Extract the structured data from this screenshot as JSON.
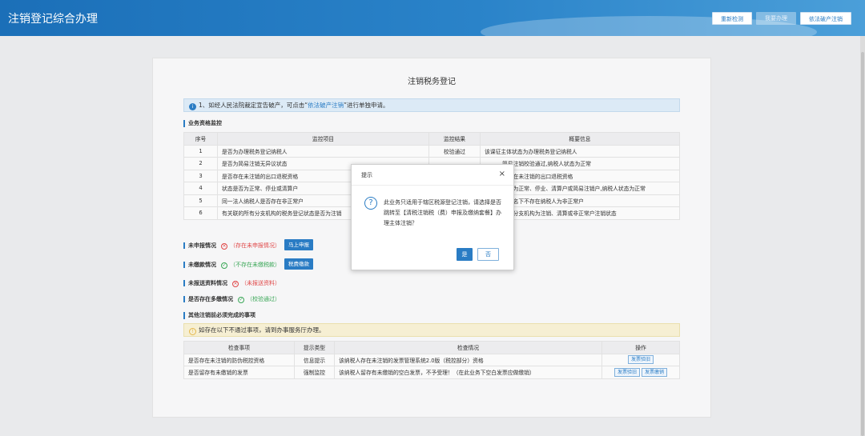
{
  "header": {
    "title": "注销登记综合办理",
    "buttons": [
      "重新检测",
      "我要办理",
      "依法破产注销"
    ]
  },
  "card": {
    "title": "注销税务登记",
    "notice": {
      "prefix": "1、如经人民法院裁定宣告破产，可点击“",
      "link": "依法破产注销",
      "suffix": "”进行单独申请。"
    },
    "business_section": "业务资格监控",
    "table1": {
      "headers": [
        "序号",
        "监控项目",
        "监控结果",
        "概要信息"
      ],
      "rows": [
        [
          "1",
          "是否为办理税务登记纳税人",
          "校验通过",
          "该课征主体状态为办理税务登记纳税人"
        ],
        [
          "2",
          "是否为简易注销无异议状态",
          "",
          "简易注销校验通过,纳税人状态为正常"
        ],
        [
          "3",
          "是否存在未注销的出口退税资格",
          "",
          "不存在未注销的出口退税资格"
        ],
        [
          "4",
          "状态是否为正常、停业或清算户",
          "",
          "状态为正常、停业、清算户或简易注销户,纳税人状态为正常"
        ],
        [
          "5",
          "同一法人纳税人是否存在非正常户",
          "",
          "代表名下不存在纳税人为非正常户"
        ],
        [
          "6",
          "有关联的所有分支机构的税务登记状态是否为注销",
          "",
          "有或分支机构为注销、清算或非正常户注销状态"
        ]
      ]
    },
    "status_rows": [
      {
        "label": "未申报情况",
        "kind": "bad",
        "text": "（存在未申报情况）",
        "button": "马上申报"
      },
      {
        "label": "未缴款情况",
        "kind": "good",
        "text": "（不存在未缴税款）",
        "button": "税费缴款"
      },
      {
        "label": "未报送资料情况",
        "kind": "bad",
        "text": "（未报送资料）",
        "button": ""
      },
      {
        "label": "是否存在多缴情况",
        "kind": "good",
        "text": "（校验通过）",
        "button": ""
      }
    ],
    "other_section": "其他注销前必须完成的事项",
    "warn": "如存在以下不通过事项，请到办事服务厅办理。",
    "table2": {
      "headers": [
        "检查事项",
        "提示类型",
        "检查情况",
        "操作"
      ],
      "rows": [
        {
          "item": "是否存在未注销的防伪税控资格",
          "type": "信息提示",
          "detail": "该纳税人存在未注销的发票管理系统2.0版（税控部分）资格",
          "ops": [
            "发票验旧"
          ]
        },
        {
          "item": "是否留存有未缴销的发票",
          "type": "强制监控",
          "detail": "该纳税人留存有未缴销的空白发票，不予受理！（在此业务下空白发票应做缴销）",
          "ops": [
            "发票验旧",
            "发票缴销"
          ]
        }
      ]
    }
  },
  "dialog": {
    "title": "提示",
    "close": "×",
    "icon": "question-icon",
    "message": "此业务只适用于辖区税源登记注销，请选择是否跳转至【清税注销税（费）申报及缴纳套餐】办理主体注销？",
    "yes": "是",
    "no": "否"
  },
  "colors": {
    "accent": "#2a7cc4",
    "bad": "#e04848",
    "good": "#3aa757",
    "warn_bg": "#f6efd3"
  }
}
